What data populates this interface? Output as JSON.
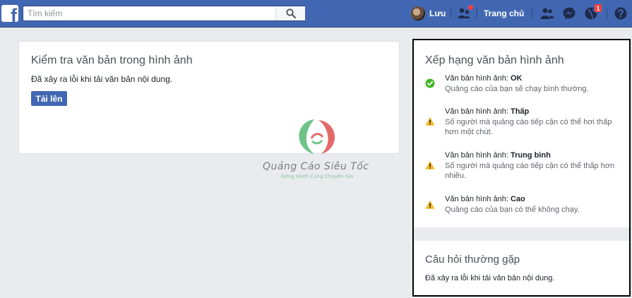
{
  "topbar": {
    "logo_letter": "f",
    "search_placeholder": "Tìm kiếm",
    "profile_name": "Lưu",
    "home_label": "Trang chủ",
    "notification_count": "1",
    "accent_color": "#4267b2"
  },
  "main": {
    "title": "Kiểm tra văn bản trong hình ảnh",
    "error_message": "Đã xảy ra lỗi khi tải văn bản nội dung.",
    "upload_label": "Tải lên"
  },
  "watermark": {
    "title": "Quảng Cáo Siêu Tốc",
    "subtitle": "Đồng Hành Cùng Chuyên Gia"
  },
  "rating": {
    "title": "Xếp hạng văn bản hình ảnh",
    "items": [
      {
        "prefix": "Văn bản hình ảnh: ",
        "level": "OK",
        "description": "Quảng cáo của bạn sẽ chạy bình thường.",
        "icon": "check-circle-icon",
        "color": "#42b72a"
      },
      {
        "prefix": "Văn bản hình ảnh: ",
        "level": "Thấp",
        "description": "Số người mà quảng cáo tiếp cận có thể hơi thấp hơn một chút.",
        "icon": "warning-icon",
        "color": "#f7b928"
      },
      {
        "prefix": "Văn bản hình ảnh: ",
        "level": "Trung bình",
        "description": "Số người mà quảng cáo tiếp cận có thể thấp hơn nhiều.",
        "icon": "warning-icon",
        "color": "#f7b928"
      },
      {
        "prefix": "Văn bản hình ảnh: ",
        "level": "Cao",
        "description": "Quảng cáo của bạn có thể không chạy.",
        "icon": "warning-icon",
        "color": "#f7b928"
      }
    ]
  },
  "faq": {
    "title": "Câu hỏi thường gặp",
    "message": "Đã xảy ra lỗi khi tải văn bản nội dung."
  }
}
